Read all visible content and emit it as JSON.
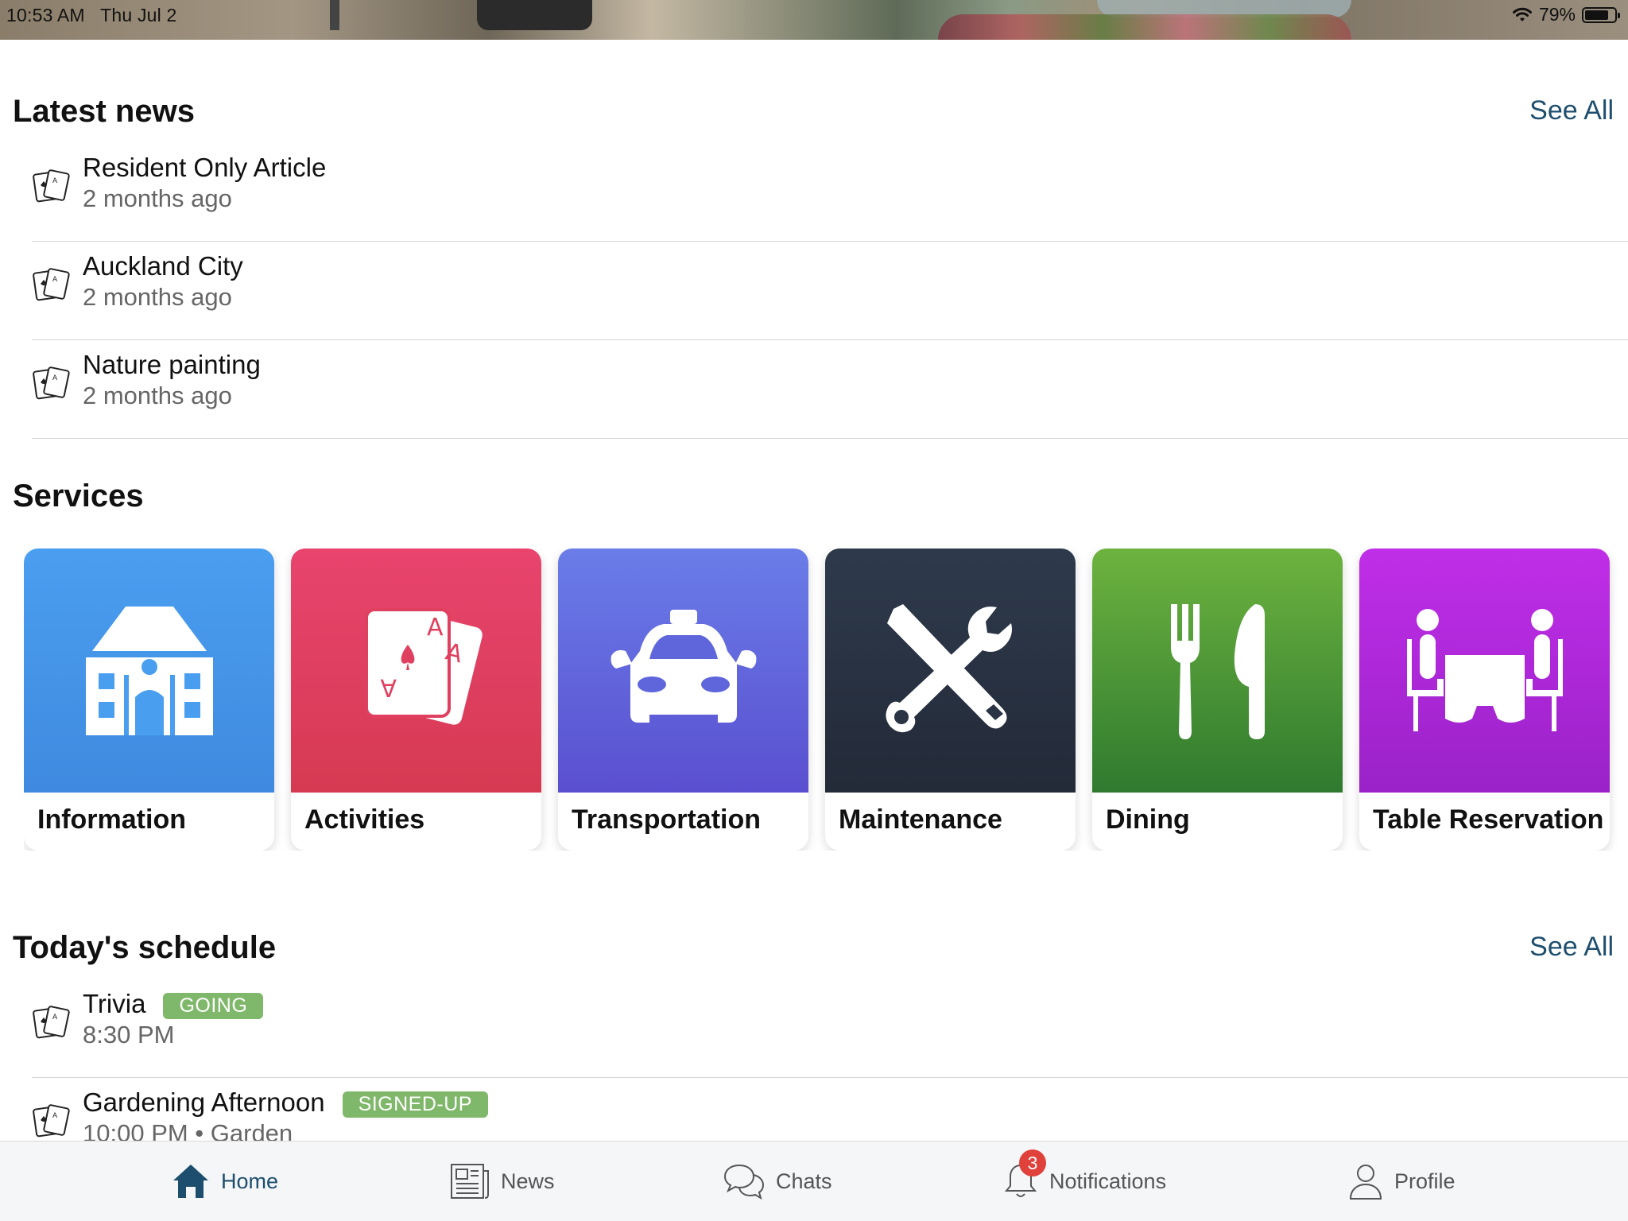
{
  "status_bar": {
    "time": "10:53 AM",
    "date": "Thu Jul 2",
    "battery": "79%",
    "battery_level": 0.79
  },
  "latest_news": {
    "title": "Latest news",
    "see_all": "See All",
    "items": [
      {
        "title": "Resident Only Article",
        "sub": "2 months ago",
        "icon": "playing-cards-icon"
      },
      {
        "title": "Auckland City",
        "sub": "2 months ago",
        "icon": "playing-cards-icon"
      },
      {
        "title": "Nature painting",
        "sub": "2 months ago",
        "icon": "playing-cards-icon"
      }
    ]
  },
  "services": {
    "title": "Services",
    "items": [
      {
        "label": "Information",
        "icon": "building-icon",
        "colors": [
          "#4a9ef0",
          "#3f8ae0"
        ]
      },
      {
        "label": "Activities",
        "icon": "playing-cards-icon",
        "colors": [
          "#e8446e",
          "#d63a52"
        ]
      },
      {
        "label": "Transportation",
        "icon": "taxi-icon",
        "colors": [
          "#6a7de8",
          "#5a4fd0"
        ]
      },
      {
        "label": "Maintenance",
        "icon": "tools-icon",
        "colors": [
          "#2e3a4c",
          "#232a38"
        ]
      },
      {
        "label": "Dining",
        "icon": "fork-knife-icon",
        "colors": [
          "#6db33f",
          "#2f7a2f"
        ]
      },
      {
        "label": "Table Reservation",
        "icon": "table-people-icon",
        "colors": [
          "#c02ee8",
          "#9a22c8"
        ]
      }
    ]
  },
  "schedule": {
    "title": "Today's schedule",
    "see_all": "See All",
    "items": [
      {
        "title": "Trivia",
        "badge": "GOING",
        "sub": "8:30 PM",
        "icon": "playing-cards-icon"
      },
      {
        "title": "Gardening Afternoon",
        "badge": "SIGNED-UP",
        "sub": "10:00 PM • Garden",
        "icon": "playing-cards-icon"
      }
    ]
  },
  "tabbar": {
    "home": "Home",
    "news": "News",
    "chats": "Chats",
    "notifications": "Notifications",
    "notifications_count": "3",
    "profile": "Profile",
    "active_tab": "Home"
  }
}
